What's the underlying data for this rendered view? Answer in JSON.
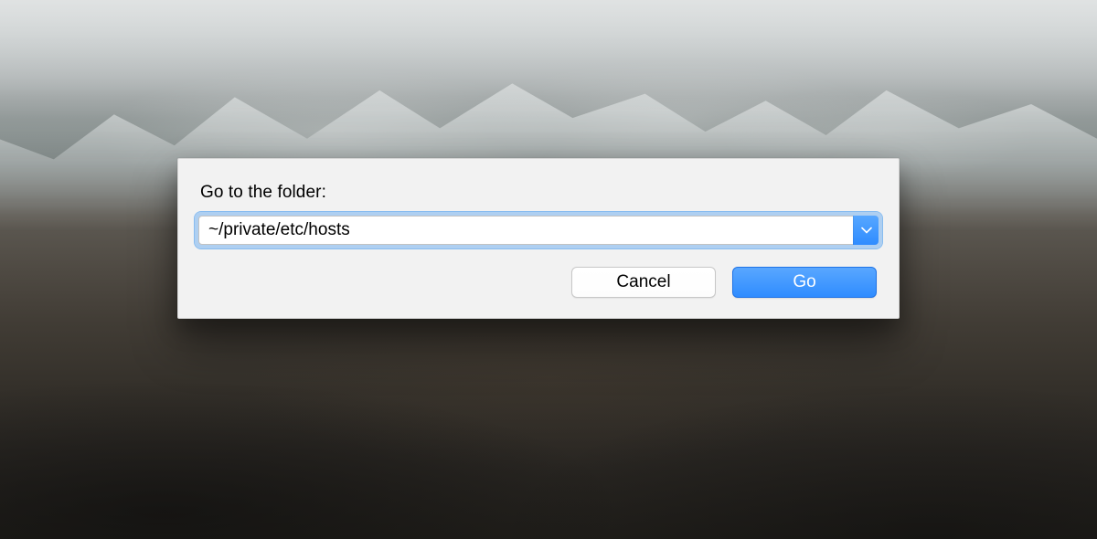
{
  "dialog": {
    "prompt": "Go to the folder:",
    "path_value": "~/private/etc/hosts",
    "buttons": {
      "cancel": "Cancel",
      "go": "Go"
    }
  },
  "colors": {
    "accent": "#2f8cff",
    "focus_ring": "#76b3f0",
    "dialog_bg": "#f2f2f2"
  }
}
